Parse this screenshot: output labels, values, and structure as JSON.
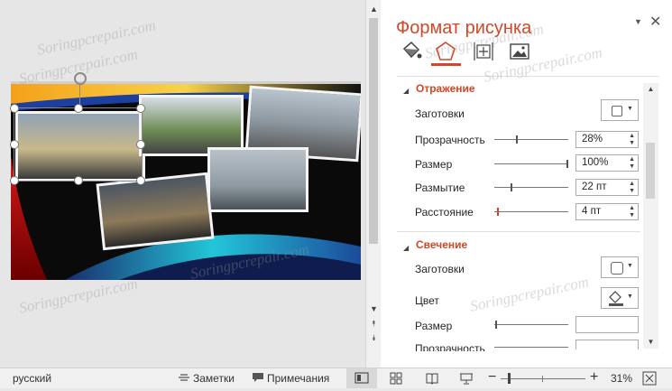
{
  "pane": {
    "title": "Формат рисунка",
    "tabs": [
      "fill-line-icon",
      "effects-icon",
      "size-properties-icon",
      "picture-icon"
    ],
    "sections": {
      "reflection": {
        "title": "Отражение",
        "presets_label": "Заготовки",
        "transparency_label": "Прозрачность",
        "transparency_value": "28%",
        "transparency_level": 0.28,
        "size_label": "Размер",
        "size_value": "100%",
        "size_level": 1.0,
        "blur_label": "Размытие",
        "blur_value": "22 пт",
        "distance_label": "Расстояние",
        "distance_value": "4 пт"
      },
      "glow": {
        "title": "Свечение",
        "presets_label": "Заготовки",
        "color_label": "Цвет",
        "size_label": "Размер",
        "transparency_label": "Прозрачность"
      }
    }
  },
  "status": {
    "language": "русский",
    "notes": "Заметки",
    "comments": "Примечания",
    "zoom": "31%"
  },
  "watermark": "Soringpcrepair.com",
  "colors": {
    "accent": "#d24726"
  }
}
